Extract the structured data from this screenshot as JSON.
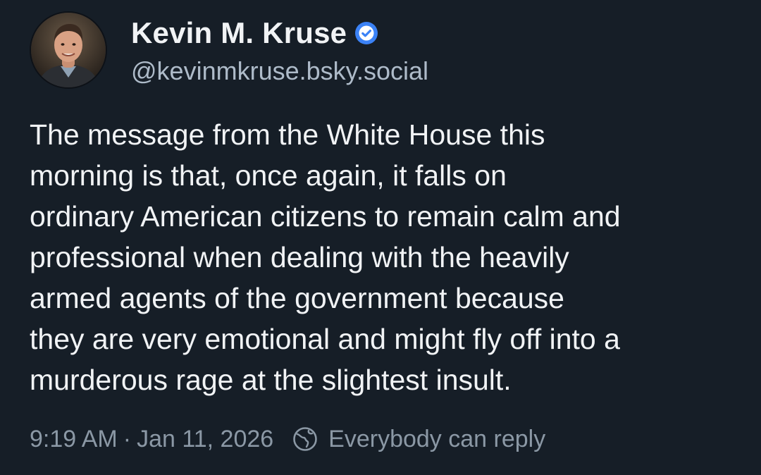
{
  "author": {
    "display_name": "Kevin M. Kruse",
    "handle": "@kevinmkruse.bsky.social",
    "verified_icon": "verified-check-icon",
    "avatar_icon": "avatar-photo"
  },
  "post": {
    "lines": [
      "The message from the White House this",
      "morning is that, once again, it falls on",
      "ordinary American citizens to remain calm and",
      "professional when dealing with the heavily",
      "armed agents of the government because",
      "they are very emotional and might fly off into a",
      "murderous rage at the slightest insult."
    ]
  },
  "meta": {
    "time": "9:19 AM",
    "separator": "·",
    "date": "Jan 11, 2026",
    "reply_icon": "globe-icon",
    "reply_setting": "Everybody can reply"
  },
  "colors": {
    "background": "#161e27",
    "text": "#f1f3f5",
    "secondary": "#aebbc9",
    "muted": "#8b98a5",
    "verified": "#3b82f6"
  }
}
